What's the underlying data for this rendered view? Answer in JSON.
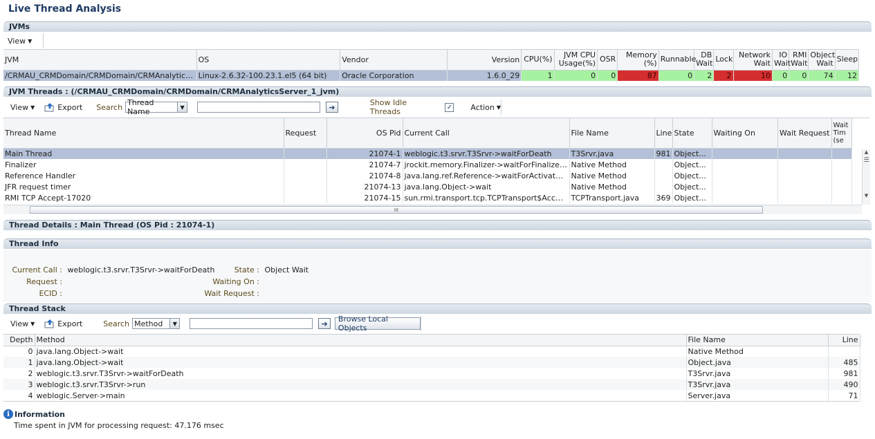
{
  "page": {
    "title": "Live Thread Analysis"
  },
  "jvms": {
    "section": "JVMs",
    "view_label": "View",
    "columns": [
      "JVM",
      "OS",
      "Vendor",
      "Version",
      "CPU(%)",
      "JVM CPU Usage(%)",
      "OSR",
      "Memory (%)",
      "Runnable",
      "DB Wait",
      "Lock",
      "Network Wait",
      "IO Wait",
      "RMI Wait",
      "Object Wait",
      "Sleep"
    ],
    "row": {
      "jvm": "/CRMAU_CRMDomain/CRMDomain/CRMAnalyticsServe...",
      "os": "Linux-2.6.32-100.23.1.el5 (64 bit)",
      "vendor": "Oracle Corporation",
      "version": "1.6.0_29",
      "cpu": "1",
      "jvmcpu": "0",
      "osr": "0",
      "memory": "87",
      "runnable": "0",
      "dbwait": "2",
      "lock": "2",
      "network": "10",
      "io": "0",
      "rmi": "0",
      "object": "74",
      "sleep": "12"
    },
    "colors": {
      "ok": "#a7f2a0",
      "alert": "#d52e2e"
    }
  },
  "threads": {
    "section": "JVM Threads : (/CRMAU_CRMDomain/CRMDomain/CRMAnalyticsServer_1_jvm)",
    "view_label": "View",
    "export_label": "Export",
    "search_label": "Search",
    "search_select": "Thread Name",
    "search_value": "",
    "idle_label": "Show Idle Threads",
    "idle_checked": true,
    "action_label": "Action",
    "columns": [
      "Thread Name",
      "Request",
      "OS Pid",
      "Current Call",
      "File Name",
      "Line",
      "State",
      "Waiting On",
      "Wait Request",
      "Wait Tim (se"
    ],
    "rows": [
      {
        "name": "Main Thread",
        "request": "",
        "pid": "21074-1",
        "call": "weblogic.t3.srvr.T3Srvr->waitForDeath",
        "file": "T3Srvr.java",
        "line": "981",
        "state": "Object...",
        "waiting": "",
        "waitreq": "",
        "selected": true
      },
      {
        "name": "Finalizer",
        "request": "",
        "pid": "21074-7",
        "call": "jrockit.memory.Finalizer->waitForFinalizees",
        "file": "Native Method",
        "line": "",
        "state": "Object...",
        "waiting": "",
        "waitreq": ""
      },
      {
        "name": "Reference Handler",
        "request": "",
        "pid": "21074-8",
        "call": "java.lang.ref.Reference->waitForActivatedQu...",
        "file": "Native Method",
        "line": "",
        "state": "Object...",
        "waiting": "",
        "waitreq": ""
      },
      {
        "name": "JFR request timer",
        "request": "",
        "pid": "21074-13",
        "call": "java.lang.Object->wait",
        "file": "Native Method",
        "line": "",
        "state": "Object...",
        "waiting": "",
        "waitreq": ""
      },
      {
        "name": "RMI TCP Accept-17020",
        "request": "",
        "pid": "21074-15",
        "call": "sun.rmi.transport.tcp.TCPTransport$AcceptLo...",
        "file": "TCPTransport.java",
        "line": "369",
        "state": "Object...",
        "waiting": "",
        "waitreq": ""
      }
    ],
    "hscroll_grip": "III"
  },
  "details": {
    "section": "Thread Details : Main Thread (OS Pid : 21074-1)"
  },
  "info": {
    "section": "Thread Info",
    "current_call_label": "Current Call :",
    "current_call": "weblogic.t3.srvr.T3Srvr->waitForDeath",
    "request_label": "Request :",
    "request": "",
    "ecid_label": "ECID :",
    "ecid": "",
    "state_label": "State :",
    "state": "Object Wait",
    "waiting_on_label": "Waiting On :",
    "waiting_on": "",
    "wait_request_label": "Wait Request :",
    "wait_request": ""
  },
  "stack": {
    "section": "Thread Stack",
    "view_label": "View",
    "export_label": "Export",
    "search_label": "Search",
    "search_select": "Method",
    "search_value": "",
    "browse_label": "Browse Local Objects",
    "columns": [
      "Depth",
      "Method",
      "File Name",
      "Line"
    ],
    "rows": [
      {
        "depth": "0",
        "method": "java.lang.Object->wait",
        "file": "Native Method",
        "line": ""
      },
      {
        "depth": "1",
        "method": "java.lang.Object->wait",
        "file": "Object.java",
        "line": "485"
      },
      {
        "depth": "2",
        "method": "weblogic.t3.srvr.T3Srvr->waitForDeath",
        "file": "T3Srvr.java",
        "line": "981"
      },
      {
        "depth": "3",
        "method": "weblogic.t3.srvr.T3Srvr->run",
        "file": "T3Srvr.java",
        "line": "490"
      },
      {
        "depth": "4",
        "method": "weblogic.Server->main",
        "file": "Server.java",
        "line": "71"
      }
    ]
  },
  "information": {
    "title": "Information",
    "text": "Time spent in JVM for processing request: 47.176 msec"
  }
}
